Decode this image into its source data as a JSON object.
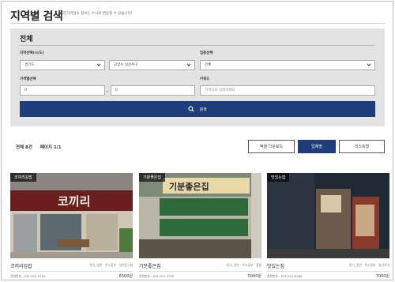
{
  "page": {
    "title": "지역별 검색",
    "subtitle": "(착한가격업소 정보는 수시로 변동될 수 있습니다)"
  },
  "filter": {
    "heading": "전체",
    "region_label": "지역선택(시/도)",
    "region_value": "경기도",
    "district_value": "고양시 일산서구",
    "industry_label": "업종선택",
    "industry_value": "전체",
    "price_label": "가격별선택",
    "price_min": "0",
    "price_max": "0",
    "keyword_label": "키워드",
    "keyword_placeholder": "가격으로 입력하세요",
    "search_label": "검색"
  },
  "results": {
    "total": "전체 8건",
    "page": "페이지 1/1"
  },
  "buttons": {
    "excel": "엑셀 다운로드",
    "by_name": "업체명",
    "list_view": "리스트형"
  },
  "cards": [
    {
      "badge": "코끼리김밥",
      "sign_text": "코끼리",
      "name": "코끼리김밥",
      "category": "한식_일반 · 주소정보 · 일산동구청",
      "tel": "전화번호 : 031-915-9199",
      "price": "6500원"
    },
    {
      "badge": "기분좋은집",
      "sign_text": "기분좋은집",
      "name": "기분좋은집",
      "category": "한식_일반 · 주소정보 · 정발",
      "tel": "전화번호 : 031-913-5720",
      "price": "5000원"
    },
    {
      "badge": "맛있는집",
      "name": "맛있는집",
      "category": "한식_일반 · 주소정보 · 일산덕이",
      "tel": "전화번호 : 031-911-6286",
      "price": "7000원"
    }
  ],
  "colors": {
    "accent": "#1f3d7a",
    "panel": "#e3e3e3"
  }
}
